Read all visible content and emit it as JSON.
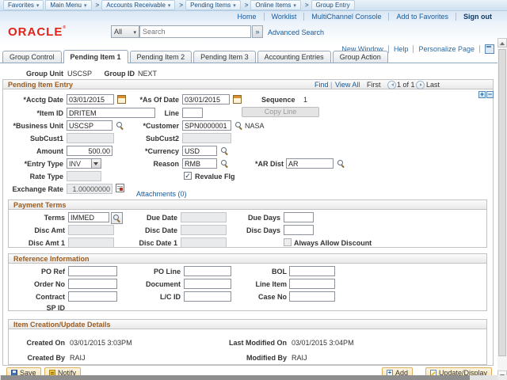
{
  "breadcrumb": {
    "separator": ">",
    "items": [
      {
        "label": "Favorites"
      },
      {
        "label": "Main Menu"
      },
      {
        "label": "Accounts Receivable"
      },
      {
        "label": "Pending Items"
      },
      {
        "label": "Online Items"
      },
      {
        "label": "Group Entry"
      }
    ]
  },
  "header_links": {
    "home": "Home",
    "worklist": "Worklist",
    "multichannel_console": "MultiChannel Console",
    "add_to_favorites": "Add to Favorites",
    "sign_out": "Sign out"
  },
  "brand": {
    "logo": "ORACLE",
    "search_scope": "All",
    "search_placeholder": "Search",
    "advanced_search": "Advanced Search"
  },
  "page_links": {
    "new_window": "New Window",
    "help": "Help",
    "personalize_page": "Personalize Page"
  },
  "tabs": [
    {
      "label": "Group Control"
    },
    {
      "label": "Pending Item 1"
    },
    {
      "label": "Pending Item 2"
    },
    {
      "label": "Pending Item 3"
    },
    {
      "label": "Accounting Entries"
    },
    {
      "label": "Group Action"
    }
  ],
  "group_keys": {
    "group_unit_label": "Group Unit",
    "group_unit_value": "USCSP",
    "group_id_label": "Group ID",
    "group_id_value": "NEXT"
  },
  "pending_item": {
    "title": "Pending Item Entry",
    "find_label": "Find",
    "view_all_label": "View All",
    "first_label": "First",
    "position": "1 of 1",
    "last_label": "Last",
    "acctg_date_label": "*Acctg Date",
    "acctg_date_value": "03/01/2015",
    "as_of_date_label": "*As Of Date",
    "as_of_date_value": "03/01/2015",
    "sequence_label": "Sequence",
    "sequence_value": "1",
    "item_id_label": "*Item ID",
    "item_id_value": "DRITEM",
    "line_label": "Line",
    "line_value": "",
    "copy_line_label": "Copy Line",
    "business_unit_label": "*Business Unit",
    "business_unit_value": "USCSP",
    "customer_label": "*Customer",
    "customer_value": "SPN0000001",
    "customer_name": "NASA",
    "subcust1_label": "SubCust1",
    "subcust2_label": "SubCust2",
    "amount_label": "Amount",
    "amount_value": "500.00",
    "currency_label": "*Currency",
    "currency_value": "USD",
    "entry_type_label": "*Entry Type",
    "entry_type_value": "INV",
    "reason_label": "Reason",
    "reason_value": "RMB",
    "ar_dist_label": "*AR Dist",
    "ar_dist_value": "AR",
    "rate_type_label": "Rate Type",
    "revalue_flg_label": "Revalue Flg",
    "revalue_flg_mark": "✓",
    "exchange_rate_label": "Exchange Rate",
    "exchange_rate_value": "1.00000000",
    "attachments_label": "Attachments (0)"
  },
  "payment_terms": {
    "title": "Payment Terms",
    "terms_label": "Terms",
    "terms_value": "IMMED",
    "due_date_label": "Due Date",
    "due_days_label": "Due Days",
    "disc_amt_label": "Disc Amt",
    "disc_date_label": "Disc Date",
    "disc_days_label": "Disc Days",
    "disc_amt_1_label": "Disc Amt 1",
    "disc_date_1_label": "Disc Date 1",
    "always_allow_discount_label": "Always Allow Discount",
    "always_allow_discount_mark": ""
  },
  "reference_information": {
    "title": "Reference Information",
    "po_ref_label": "PO Ref",
    "po_line_label": "PO Line",
    "bol_label": "BOL",
    "order_no_label": "Order No",
    "document_label": "Document",
    "line_item_label": "Line Item",
    "contract_label": "Contract",
    "lc_id_label": "L/C ID",
    "case_no_label": "Case No",
    "sp_id_label": "SP ID"
  },
  "item_details": {
    "title": "Item Creation/Update Details",
    "created_on_label": "Created On",
    "created_on_value": "03/01/2015  3:03PM",
    "last_modified_on_label": "Last Modified On",
    "last_modified_on_value": "03/01/2015  3:04PM",
    "created_by_label": "Created By",
    "created_by_value": "RAIJ",
    "modified_by_label": "Modified By",
    "modified_by_value": "RAIJ"
  },
  "toolbar": {
    "save_label": "Save",
    "notify_label": "Notify",
    "add_label": "Add",
    "update_display_label": "Update/Display"
  },
  "colors": {
    "brand_red": "#e2231a",
    "link_blue": "#15599d",
    "section_title_brown": "#9a5b20"
  }
}
